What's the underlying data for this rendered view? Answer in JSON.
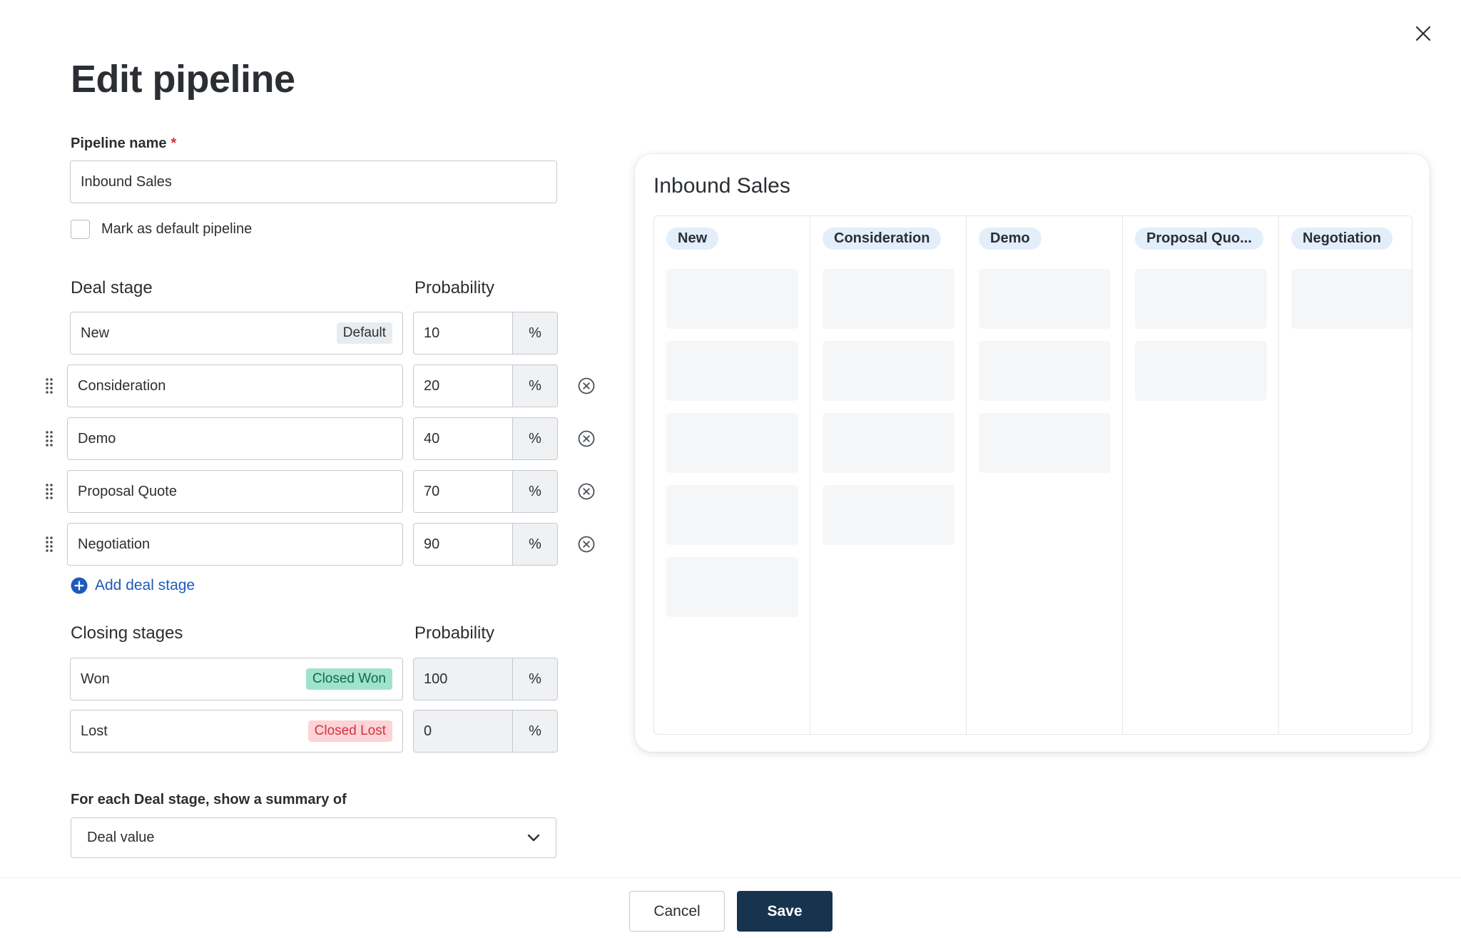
{
  "dialog": {
    "title": "Edit pipeline",
    "close_icon": "close-icon"
  },
  "form": {
    "pipeline_name_label": "Pipeline name",
    "required_marker": "*",
    "pipeline_name_value": "Inbound Sales",
    "default_checkbox_label": "Mark as default pipeline",
    "default_checked": false,
    "deal_stage_heading": "Deal stage",
    "probability_heading": "Probability",
    "percent_unit": "%",
    "first_stage": {
      "name": "New",
      "tag": "Default",
      "probability": "10"
    },
    "stages": [
      {
        "name": "Consideration",
        "probability": "20"
      },
      {
        "name": "Demo",
        "probability": "40"
      },
      {
        "name": "Proposal Quote",
        "probability": "70"
      },
      {
        "name": "Negotiation",
        "probability": "90"
      }
    ],
    "add_stage_label": "Add deal stage",
    "closing_heading": "Closing stages",
    "closing_probability_heading": "Probability",
    "closing_stages": [
      {
        "name": "Won",
        "tag": "Closed Won",
        "probability": "100"
      },
      {
        "name": "Lost",
        "tag": "Closed Lost",
        "probability": "0"
      }
    ],
    "summary_label": "For each Deal stage, show a summary of",
    "summary_value": "Deal value"
  },
  "preview": {
    "title": "Inbound Sales",
    "columns": [
      {
        "label": "New",
        "cards": 5
      },
      {
        "label": "Consideration",
        "cards": 4
      },
      {
        "label": "Demo",
        "cards": 3
      },
      {
        "label": "Proposal Quo...",
        "cards": 2
      },
      {
        "label": "Negotiation",
        "cards": 1
      }
    ]
  },
  "footer": {
    "cancel_label": "Cancel",
    "save_label": "Save"
  },
  "colors": {
    "primary": "#17344f",
    "link": "#1e5ab9",
    "won_tag": "#9fe3cc",
    "lost_tag": "#fcd3d6",
    "column_pill": "#e3eefb"
  }
}
